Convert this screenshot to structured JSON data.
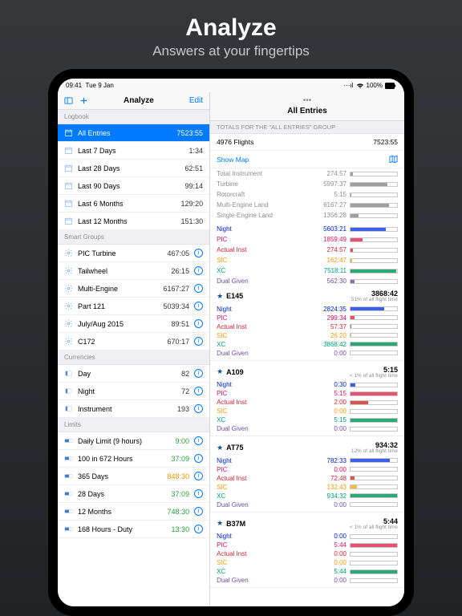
{
  "promo": {
    "title": "Analyze",
    "subtitle": "Answers at your fingertips"
  },
  "statusbar": {
    "time": "09:41",
    "date": "Tue 9 Jan",
    "battery": "100%"
  },
  "left": {
    "toolbar": {
      "title": "Analyze",
      "edit": "Edit"
    },
    "sections": {
      "logbook": "Logbook",
      "smart": "Smart Groups",
      "currencies": "Currencies",
      "limits": "Limits"
    },
    "logbook": [
      {
        "label": "All Entries",
        "value": "7523:55",
        "selected": true
      },
      {
        "label": "Last 7 Days",
        "value": "1:34"
      },
      {
        "label": "Last 28 Days",
        "value": "62:51"
      },
      {
        "label": "Last 90 Days",
        "value": "99:14"
      },
      {
        "label": "Last 6 Months",
        "value": "129:20"
      },
      {
        "label": "Last 12 Months",
        "value": "151:30"
      }
    ],
    "smart": [
      {
        "label": "PIC Turbine",
        "value": "467:05"
      },
      {
        "label": "Tailwheel",
        "value": "26:15"
      },
      {
        "label": "Multi-Engine",
        "value": "6167:27"
      },
      {
        "label": "Part 121",
        "value": "5039:34"
      },
      {
        "label": "July/Aug 2015",
        "value": "89:51"
      },
      {
        "label": "C172",
        "value": "670:17"
      }
    ],
    "currencies": [
      {
        "label": "Day",
        "value": "82"
      },
      {
        "label": "Night",
        "value": "72"
      },
      {
        "label": "Instrument",
        "value": "193"
      }
    ],
    "limits": [
      {
        "label": "Daily Limit (9 hours)",
        "value": "9:00",
        "color": "#2aa03c"
      },
      {
        "label": "100 in 672 Hours",
        "value": "37:09",
        "color": "#2aa03c"
      },
      {
        "label": "365 Days",
        "value": "848:30",
        "color": "#e39600"
      },
      {
        "label": "28 Days",
        "value": "37:09",
        "color": "#2aa03c"
      },
      {
        "label": "12 Months",
        "value": "748:30",
        "color": "#2aa03c"
      },
      {
        "label": "168 Hours - Duty",
        "value": "13:30",
        "color": "#2aa03c"
      }
    ]
  },
  "right": {
    "title": "All Entries",
    "totals_header": "TOTALS FOR THE \"ALL ENTRIES\" GROUP",
    "flights": "4976 Flights",
    "flights_val": "7523:55",
    "show_map": "Show Map",
    "summary": [
      {
        "l": "Total Instrument",
        "v": "274:57",
        "fill": 5,
        "cls": "b-gray"
      },
      {
        "l": "Turbine",
        "v": "5997:37",
        "fill": 80,
        "cls": "b-gray"
      },
      {
        "l": "Rotorcraft",
        "v": "5:15",
        "fill": 1,
        "cls": "b-gray"
      },
      {
        "l": "Multi-Engine Land",
        "v": "6167:27",
        "fill": 82,
        "cls": "b-gray"
      },
      {
        "l": "Single-Engine Land",
        "v": "1356:28",
        "fill": 18,
        "cls": "b-gray"
      }
    ],
    "summary2": [
      {
        "l": "Night",
        "v": "5603:21",
        "fill": 75,
        "cls": "b-night",
        "lc": "c-night"
      },
      {
        "l": "PIC",
        "v": "1859:49",
        "fill": 25,
        "cls": "b-pic",
        "lc": "c-pic"
      },
      {
        "l": "Actual Inst",
        "v": "274:57",
        "fill": 5,
        "cls": "b-ai",
        "lc": "c-ai"
      },
      {
        "l": "SIC",
        "v": "162:47",
        "fill": 3,
        "cls": "b-sic",
        "lc": "c-sic"
      },
      {
        "l": "XC",
        "v": "7518:11",
        "fill": 99,
        "cls": "b-xc",
        "lc": "c-xc"
      },
      {
        "l": "Dual Given",
        "v": "562:30",
        "fill": 8,
        "cls": "b-dg",
        "lc": "c-dg"
      }
    ],
    "groups": [
      {
        "name": "E145",
        "total": "3868:42",
        "sub": "51% of all flight time",
        "rows": [
          {
            "l": "Night",
            "v": "2824:35",
            "fill": 73,
            "cls": "b-night",
            "lc": "c-night"
          },
          {
            "l": "PIC",
            "v": "299:34",
            "fill": 8,
            "cls": "b-pic",
            "lc": "c-pic"
          },
          {
            "l": "Actual Inst",
            "v": "57:37",
            "fill": 2,
            "cls": "b-ai",
            "lc": "c-ai"
          },
          {
            "l": "SIC",
            "v": "26:20",
            "fill": 1,
            "cls": "b-sic",
            "lc": "c-sic"
          },
          {
            "l": "XC",
            "v": "3868:42",
            "fill": 100,
            "cls": "b-xc",
            "lc": "c-xc"
          },
          {
            "l": "Dual Given",
            "v": "0:00",
            "fill": 0,
            "cls": "b-dg",
            "lc": "c-dg"
          }
        ]
      },
      {
        "name": "A109",
        "total": "5:15",
        "sub": "< 1% of all flight time",
        "rows": [
          {
            "l": "Night",
            "v": "0:30",
            "fill": 10,
            "cls": "b-night",
            "lc": "c-night"
          },
          {
            "l": "PIC",
            "v": "5:15",
            "fill": 100,
            "cls": "b-pic",
            "lc": "c-pic"
          },
          {
            "l": "Actual Inst",
            "v": "2:00",
            "fill": 38,
            "cls": "b-ai",
            "lc": "c-ai"
          },
          {
            "l": "SIC",
            "v": "0:00",
            "fill": 0,
            "cls": "b-sic",
            "lc": "c-sic"
          },
          {
            "l": "XC",
            "v": "5:15",
            "fill": 100,
            "cls": "b-xc",
            "lc": "c-xc"
          },
          {
            "l": "Dual Given",
            "v": "0:00",
            "fill": 0,
            "cls": "b-dg",
            "lc": "c-dg"
          }
        ]
      },
      {
        "name": "AT75",
        "total": "934:32",
        "sub": "12% of all flight time",
        "rows": [
          {
            "l": "Night",
            "v": "782:33",
            "fill": 84,
            "cls": "b-night",
            "lc": "c-night"
          },
          {
            "l": "PIC",
            "v": "0:00",
            "fill": 0,
            "cls": "b-pic",
            "lc": "c-pic"
          },
          {
            "l": "Actual Inst",
            "v": "72:48",
            "fill": 8,
            "cls": "b-ai",
            "lc": "c-ai"
          },
          {
            "l": "SIC",
            "v": "132:43",
            "fill": 14,
            "cls": "b-sic",
            "lc": "c-sic"
          },
          {
            "l": "XC",
            "v": "934:32",
            "fill": 100,
            "cls": "b-xc",
            "lc": "c-xc"
          },
          {
            "l": "Dual Given",
            "v": "0:00",
            "fill": 0,
            "cls": "b-dg",
            "lc": "c-dg"
          }
        ]
      },
      {
        "name": "B37M",
        "total": "5:44",
        "sub": "< 1% of all flight time",
        "rows": [
          {
            "l": "Night",
            "v": "0:00",
            "fill": 0,
            "cls": "b-night",
            "lc": "c-night"
          },
          {
            "l": "PIC",
            "v": "5:44",
            "fill": 100,
            "cls": "b-pic",
            "lc": "c-pic"
          },
          {
            "l": "Actual Inst",
            "v": "0:00",
            "fill": 0,
            "cls": "b-ai",
            "lc": "c-ai"
          },
          {
            "l": "SIC",
            "v": "0:00",
            "fill": 0,
            "cls": "b-sic",
            "lc": "c-sic"
          },
          {
            "l": "XC",
            "v": "5:44",
            "fill": 100,
            "cls": "b-xc",
            "lc": "c-xc"
          },
          {
            "l": "Dual Given",
            "v": "0:00",
            "fill": 0,
            "cls": "b-dg",
            "lc": "c-dg"
          }
        ]
      }
    ]
  }
}
